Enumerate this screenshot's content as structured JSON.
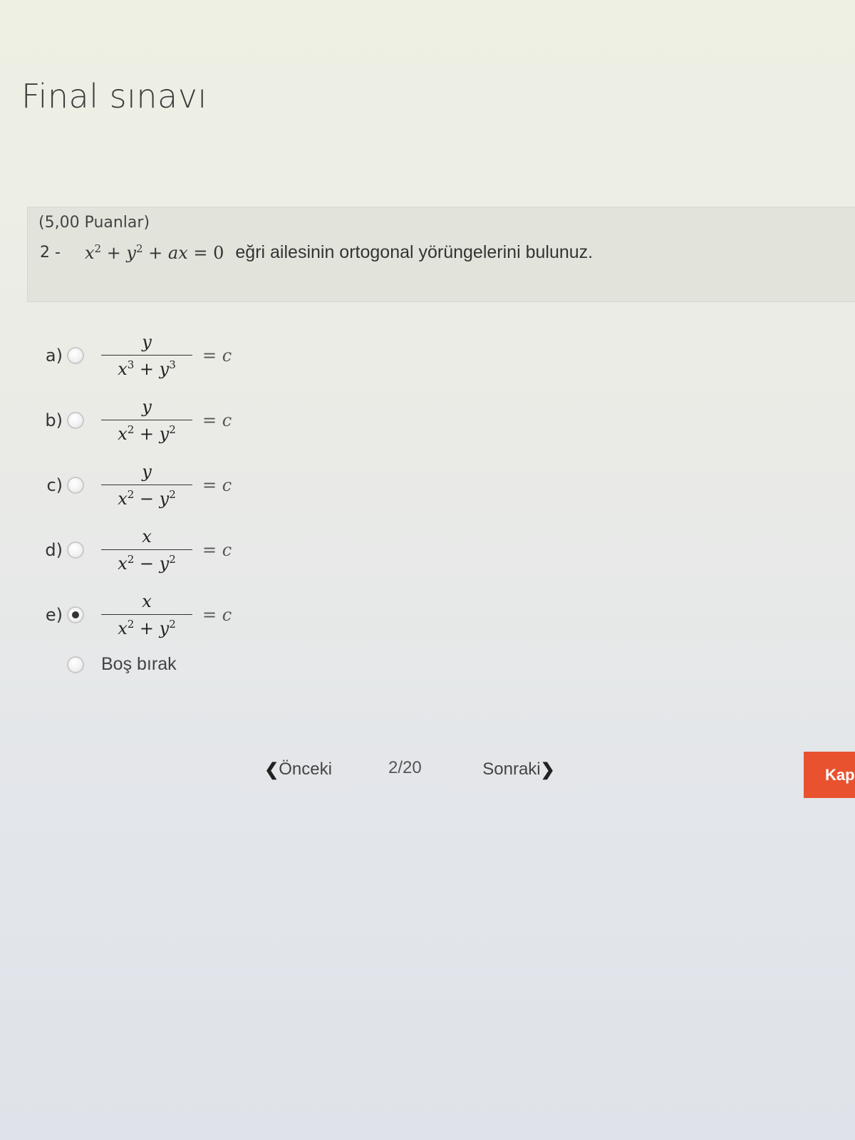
{
  "page": {
    "title": "Final sınavı"
  },
  "question": {
    "points": "(5,00 Puanlar)",
    "number": "2 -",
    "equation": {
      "x": "x",
      "exp": "2",
      "plus1": " + ",
      "y": "y",
      "plus2": " + ",
      "ax": "ax",
      "eq": " = ",
      "zero": "0"
    },
    "text": "eğri ailesinin ortogonal yörüngelerini bulunuz."
  },
  "options": [
    {
      "label": "a)",
      "numerator": "y",
      "den_left": "x",
      "den_left_exp": "3",
      "den_op": " + ",
      "den_right": "y",
      "den_right_exp": "3",
      "rhs": "= c",
      "selected": false
    },
    {
      "label": "b)",
      "numerator": "y",
      "den_left": "x",
      "den_left_exp": "2",
      "den_op": " + ",
      "den_right": "y",
      "den_right_exp": "2",
      "rhs": "= c",
      "selected": false
    },
    {
      "label": "c)",
      "numerator": "y",
      "den_left": "x",
      "den_left_exp": "2",
      "den_op": " − ",
      "den_right": "y",
      "den_right_exp": "2",
      "rhs": "= c",
      "selected": false
    },
    {
      "label": "d)",
      "numerator": "x",
      "den_left": "x",
      "den_left_exp": "2",
      "den_op": " − ",
      "den_right": "y",
      "den_right_exp": "2",
      "rhs": "= c",
      "selected": false
    },
    {
      "label": "e)",
      "numerator": "x",
      "den_left": "x",
      "den_left_exp": "2",
      "den_op": " + ",
      "den_right": "y",
      "den_right_exp": "2",
      "rhs": "= c",
      "selected": true
    }
  ],
  "skip_option": {
    "label": "Boş bırak",
    "selected": false
  },
  "navigation": {
    "prev_label": "Önceki",
    "prev_icon": "chevron-left-icon",
    "page_indicator": "2/20",
    "next_label": "Sonraki",
    "next_icon": "chevron-right-icon",
    "finish_label": "Kap"
  },
  "colors": {
    "finish_button": "#e8522e",
    "question_box": "#e2e4dc"
  }
}
